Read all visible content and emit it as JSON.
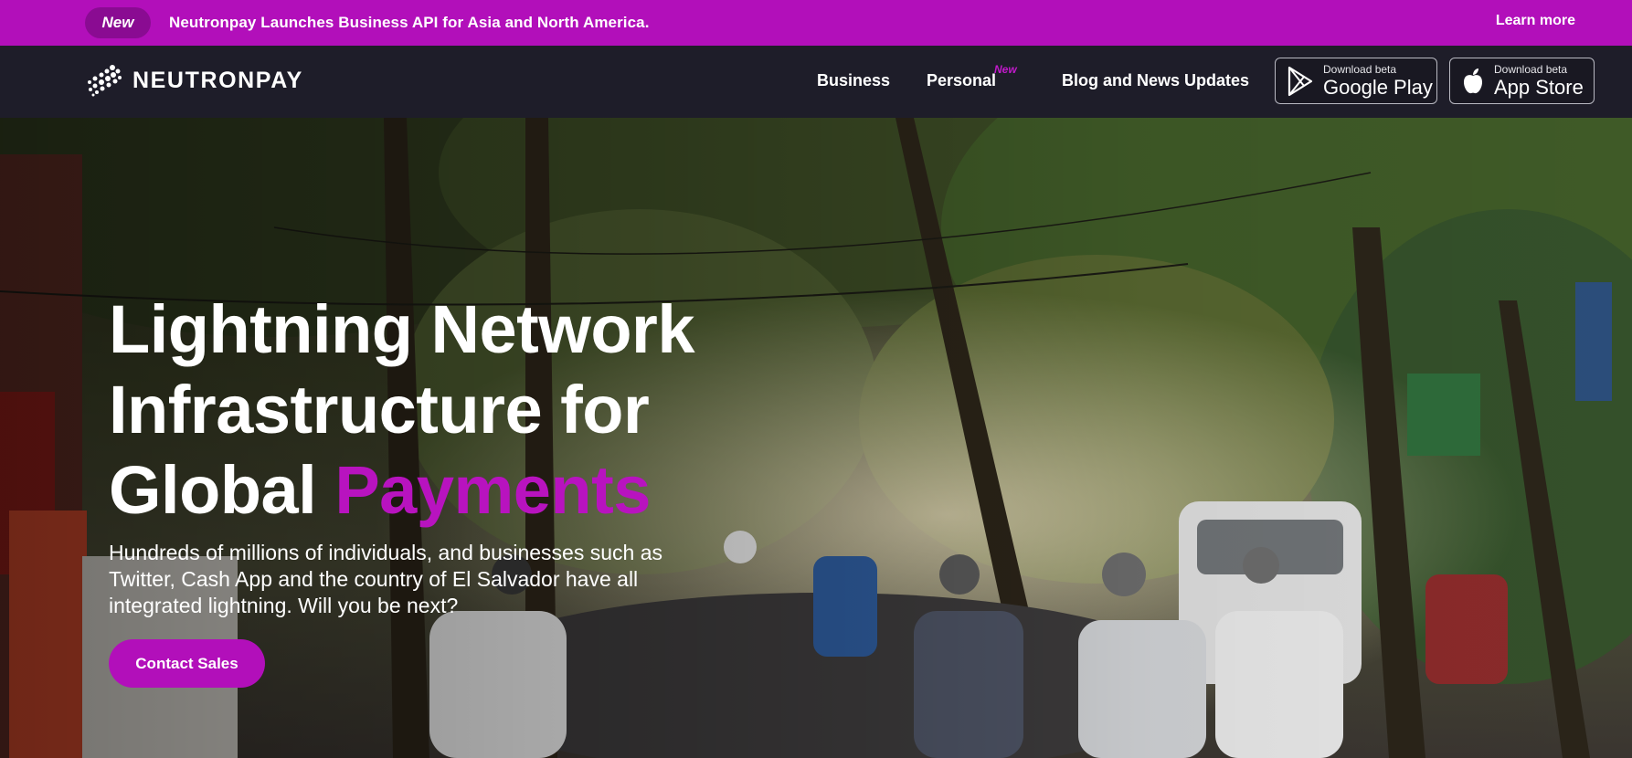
{
  "announcement": {
    "badge": "New",
    "text": "Neutronpay Launches Business API for Asia and North America.",
    "link": "Learn more",
    "bg_color": "#b20fba"
  },
  "nav": {
    "brand": "NEUTRONPAY",
    "logo_icon": "dotted-sphere-logo",
    "links": [
      {
        "label": "Business"
      },
      {
        "label": "Personal",
        "tag": "New"
      },
      {
        "label": "Blog and News Updates"
      }
    ],
    "stores": [
      {
        "small": "Download beta",
        "big": "Google Play",
        "icon": "google-play-icon"
      },
      {
        "small": "Download beta",
        "big": "App Store",
        "icon": "apple-icon"
      }
    ]
  },
  "hero": {
    "title_line1": "Lightning Network",
    "title_line2": "Infrastructure for",
    "title_line3_plain": "Global",
    "title_line3_accent": "Payments",
    "accent_color": "#b813bf",
    "subtitle": "Hundreds of millions of individuals, and businesses such as Twitter, Cash App and the country of El Salvador have all integrated lightning. Will you be next?",
    "cta": "Contact Sales"
  }
}
